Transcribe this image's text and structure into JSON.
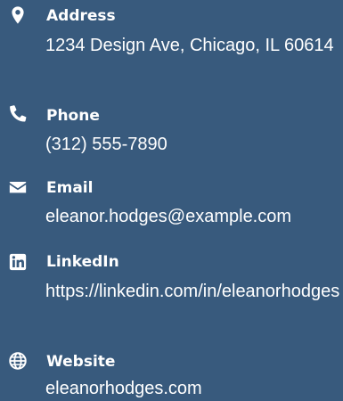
{
  "contact": {
    "address": {
      "label": "Address",
      "value": "1234 Design Ave, Chicago, IL 60614",
      "icon": "map-marker-icon"
    },
    "phone": {
      "label": "Phone",
      "value": "(312) 555-7890",
      "icon": "phone-icon"
    },
    "email": {
      "label": "Email",
      "value": "eleanor.hodges@example.com",
      "icon": "envelope-icon"
    },
    "linkedin": {
      "label": "LinkedIn",
      "value": "https://linkedin.com/in/eleanorhodges",
      "icon": "linkedin-icon"
    },
    "website": {
      "label": "Website",
      "value": "eleanorhodges.com",
      "icon": "globe-icon"
    }
  },
  "colors": {
    "background": "#385a7d",
    "text": "#ffffff"
  }
}
